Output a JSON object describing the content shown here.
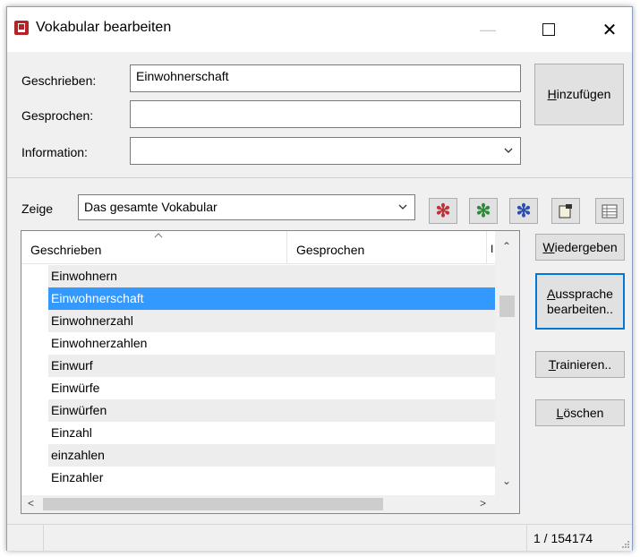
{
  "window": {
    "title": "Vokabular bearbeiten",
    "min_glyph": "—",
    "close_glyph": "✕"
  },
  "form": {
    "written_label": "Geschrieben:",
    "written_value": "Einwohnerschaft",
    "spoken_label": "Gesprochen:",
    "spoken_value": "",
    "info_label": "Information:",
    "info_value": ""
  },
  "buttons": {
    "add_prefix": "H",
    "add_rest": "inzufügen",
    "play_prefix": "W",
    "play_rest": "iedergeben",
    "pron_line1_prefix": "A",
    "pron_line1_rest": "ussprache",
    "pron_line2": "bearbeiten..",
    "train_prefix": "T",
    "train_rest": "rainieren..",
    "delete_prefix": "L",
    "delete_rest": "öschen"
  },
  "filter": {
    "label": "Zeige",
    "value": "Das gesamte Vokabular"
  },
  "toolbar_icons": [
    "asterisk-red-icon",
    "asterisk-green-icon",
    "asterisk-blue-icon",
    "edit-note-icon",
    "grid-icon"
  ],
  "colors": {
    "selection": "#3399ff",
    "asterisk_red": "#c0323a",
    "asterisk_green": "#2e8b3a",
    "asterisk_blue": "#2c4fb0",
    "default_button_border": "#0078d7"
  },
  "table": {
    "columns": [
      "Geschrieben",
      "Gesprochen",
      "I"
    ],
    "rows": [
      "Einwohnern",
      "Einwohnerschaft",
      "Einwohnerzahl",
      "Einwohnerzahlen",
      "Einwurf",
      "Einwürfe",
      "Einwürfen",
      "Einzahl",
      "einzahlen",
      "Einzahler"
    ],
    "selected_row": "Einwohnerschaft"
  },
  "status": {
    "count": "1 / 154174"
  }
}
